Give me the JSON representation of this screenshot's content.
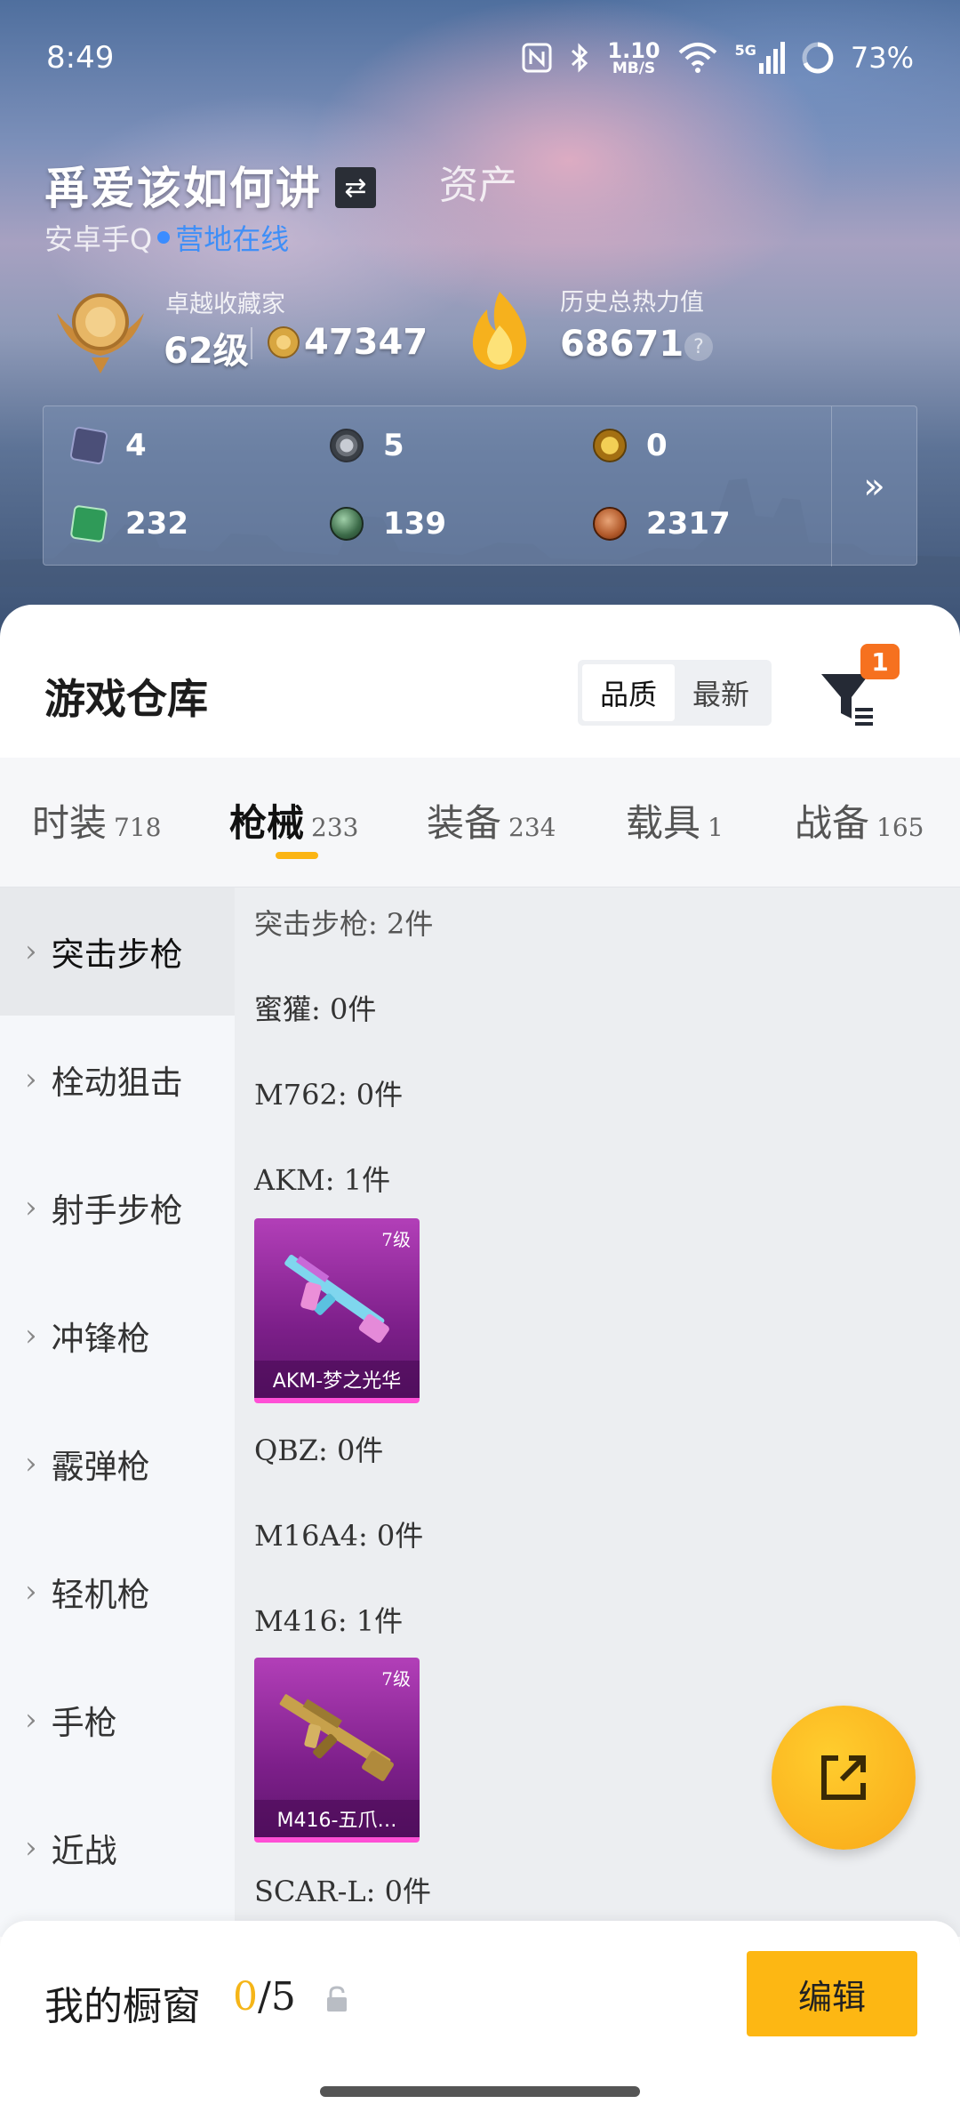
{
  "status": {
    "time": "8:49",
    "net_speed_value": "1.10",
    "net_speed_unit": "MB/S",
    "signal": "5G",
    "battery": "73%",
    "icons": [
      "nfc-icon",
      "bluetooth-icon",
      "wifi-icon",
      "signal-icon",
      "battery-icon"
    ]
  },
  "profile": {
    "name": "爯爱该如何讲",
    "assets_tab": "资产",
    "platform": "安卓手Q",
    "online_status": "营地在线",
    "collector_title": "卓越收藏家",
    "level": "62级",
    "coins": "47347",
    "heat_label": "历史总热力值",
    "heat_value": "68671",
    "help": "?"
  },
  "resources": [
    {
      "icon": "card-icon",
      "value": "4",
      "color": "#5a5f8a"
    },
    {
      "icon": "silver-coin-icon",
      "value": "5",
      "color": "#9aa0aa"
    },
    {
      "icon": "gold-coin-icon",
      "value": "0",
      "color": "#d5a522"
    },
    {
      "icon": "green-card-icon",
      "value": "232",
      "color": "#3aa860"
    },
    {
      "icon": "green-orb-icon",
      "value": "139",
      "color": "#4e7a5a"
    },
    {
      "icon": "bronze-coin-icon",
      "value": "2317",
      "color": "#b8652e"
    }
  ],
  "resources_more": "»",
  "warehouse": {
    "title": "游戏仓库",
    "sort_options": [
      "品质",
      "最新"
    ],
    "filter_badge": "1"
  },
  "categories": [
    {
      "name": "时装",
      "count": "718"
    },
    {
      "name": "枪械",
      "count": "233"
    },
    {
      "name": "装备",
      "count": "234"
    },
    {
      "name": "载具",
      "count": "1"
    },
    {
      "name": "战备",
      "count": "165"
    }
  ],
  "side_nav": [
    "突击步枪",
    "栓动狙击",
    "射手步枪",
    "冲锋枪",
    "霰弹枪",
    "轻机枪",
    "手枪",
    "近战"
  ],
  "weapons": {
    "header": "突击步枪: 2件",
    "honey_badger": "蜜獾: 0件",
    "m762": "M762: 0件",
    "akm": "AKM: 1件",
    "qbz": "QBZ: 0件",
    "m16a4": "M16A4: 0件",
    "m416": "M416: 1件",
    "scar": "SCAR-L: 0件"
  },
  "skins": {
    "akm_level": "7级",
    "akm_name": "AKM-梦之光华",
    "m416_level": "7级",
    "m416_name": "M416-五爪…"
  },
  "showcase": {
    "title": "我的橱窗",
    "used": "0",
    "total": "/5",
    "edit_label": "编辑"
  }
}
